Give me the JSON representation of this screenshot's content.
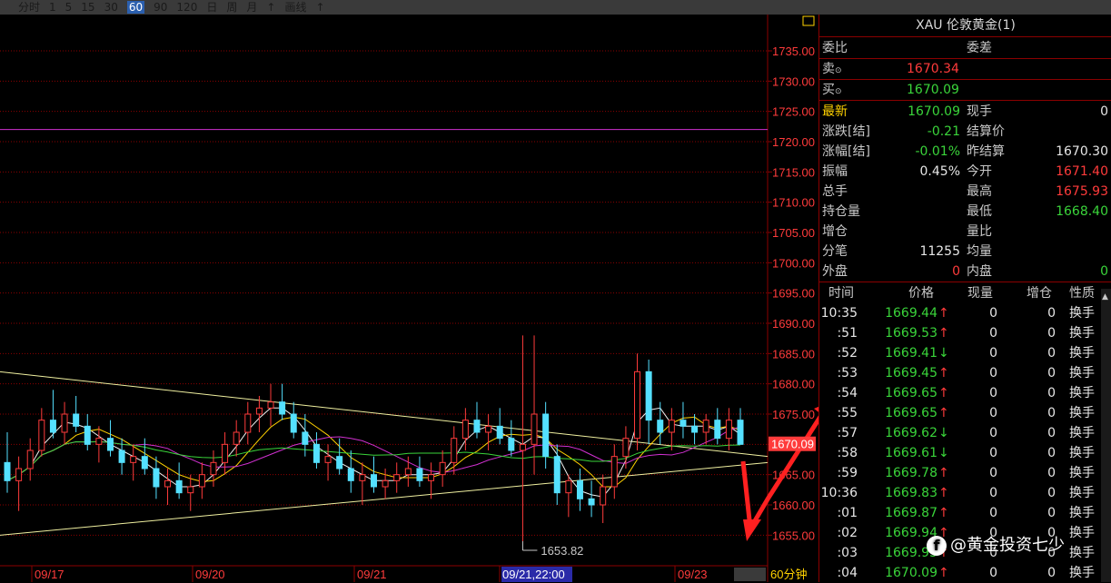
{
  "topbar": {
    "items": [
      "分时",
      "1",
      "5",
      "15",
      "30",
      "60",
      "90",
      "120",
      "日",
      "周",
      "月",
      "↑",
      "画线",
      "↑"
    ],
    "selected_index": 5
  },
  "chart_data": {
    "type": "candlestick",
    "timeframe_label": "60分钟",
    "ylim": [
      1651,
      1741
    ],
    "y_ticks": [
      "1735.00",
      "1730.00",
      "1725.00",
      "1720.00",
      "1715.00",
      "1710.00",
      "1705.00",
      "1700.00",
      "1695.00",
      "1690.00",
      "1685.00",
      "1680.00",
      "1675.00",
      "1670.00",
      "1665.00",
      "1660.00",
      "1655.00"
    ],
    "x_labels": [
      "09/17",
      "09/20",
      "09/21",
      "09/21,22:00",
      "09/23"
    ],
    "x_label_selected": "09/21,22:00",
    "min_annotation": "1653.82",
    "current_price_tag": "1670.09",
    "candles": [
      [
        1667,
        1672,
        1662,
        1664
      ],
      [
        1664,
        1668,
        1659,
        1666
      ],
      [
        1666,
        1671,
        1664,
        1669
      ],
      [
        1669,
        1676,
        1668,
        1674
      ],
      [
        1674,
        1679,
        1671,
        1672
      ],
      [
        1672,
        1677,
        1670,
        1675
      ],
      [
        1675,
        1678,
        1672,
        1673
      ],
      [
        1673,
        1675,
        1669,
        1670
      ],
      [
        1670,
        1673,
        1667,
        1671
      ],
      [
        1671,
        1674,
        1668,
        1669
      ],
      [
        1669,
        1671,
        1665,
        1667
      ],
      [
        1667,
        1670,
        1664,
        1668
      ],
      [
        1668,
        1671,
        1665,
        1666
      ],
      [
        1666,
        1668,
        1661,
        1663
      ],
      [
        1663,
        1666,
        1660,
        1664
      ],
      [
        1664,
        1667,
        1661,
        1662
      ],
      [
        1662,
        1665,
        1659,
        1663
      ],
      [
        1663,
        1667,
        1661,
        1665
      ],
      [
        1665,
        1669,
        1663,
        1667
      ],
      [
        1667,
        1672,
        1665,
        1670
      ],
      [
        1670,
        1674,
        1668,
        1672
      ],
      [
        1672,
        1677,
        1670,
        1675
      ],
      [
        1675,
        1678,
        1672,
        1676
      ],
      [
        1676,
        1680,
        1673,
        1677
      ],
      [
        1677,
        1680,
        1674,
        1675
      ],
      [
        1675,
        1677,
        1671,
        1672
      ],
      [
        1672,
        1675,
        1668,
        1670
      ],
      [
        1670,
        1672,
        1666,
        1667
      ],
      [
        1667,
        1670,
        1664,
        1668
      ],
      [
        1668,
        1671,
        1665,
        1666
      ],
      [
        1666,
        1669,
        1662,
        1664
      ],
      [
        1664,
        1667,
        1660,
        1665
      ],
      [
        1665,
        1668,
        1662,
        1663
      ],
      [
        1663,
        1666,
        1661,
        1664
      ],
      [
        1664,
        1667,
        1662,
        1665
      ],
      [
        1665,
        1668,
        1663,
        1666
      ],
      [
        1666,
        1668,
        1663,
        1664
      ],
      [
        1664,
        1667,
        1661,
        1665
      ],
      [
        1665,
        1669,
        1663,
        1667
      ],
      [
        1667,
        1673,
        1665,
        1671
      ],
      [
        1671,
        1676,
        1669,
        1674
      ],
      [
        1674,
        1677,
        1671,
        1672
      ],
      [
        1672,
        1675,
        1669,
        1673
      ],
      [
        1673,
        1676,
        1670,
        1671
      ],
      [
        1671,
        1674,
        1668,
        1669
      ],
      [
        1669,
        1688,
        1654,
        1670
      ],
      [
        1670,
        1688,
        1665,
        1675
      ],
      [
        1675,
        1677,
        1666,
        1668
      ],
      [
        1668,
        1670,
        1660,
        1662
      ],
      [
        1662,
        1665,
        1658,
        1664
      ],
      [
        1664,
        1666,
        1659,
        1661
      ],
      [
        1661,
        1664,
        1658,
        1660
      ],
      [
        1660,
        1665,
        1657,
        1663
      ],
      [
        1663,
        1670,
        1661,
        1668
      ],
      [
        1668,
        1673,
        1666,
        1671
      ],
      [
        1671,
        1685,
        1669,
        1682
      ],
      [
        1682,
        1684,
        1670,
        1674
      ],
      [
        1674,
        1677,
        1670,
        1672
      ],
      [
        1672,
        1676,
        1669,
        1674
      ],
      [
        1674,
        1677,
        1671,
        1673
      ],
      [
        1673,
        1675,
        1670,
        1672
      ],
      [
        1672,
        1675,
        1670,
        1674
      ],
      [
        1674,
        1676,
        1670,
        1671
      ],
      [
        1671,
        1676,
        1669,
        1674
      ],
      [
        1674,
        1676,
        1670,
        1670
      ]
    ]
  },
  "panel": {
    "title": "XAU 伦敦黄金(1)",
    "header": {
      "weibi_label": "委比",
      "weicha_label": "委差"
    },
    "sell": {
      "label": "卖",
      "value": "1670.34"
    },
    "buy": {
      "label": "买",
      "value": "1670.09"
    },
    "quotes": [
      {
        "l1": "最新",
        "v1": "1670.09",
        "c1": "green",
        "l2": "现手",
        "v2": "0",
        "c2": "white",
        "l1c": "yellow"
      },
      {
        "l1": "涨跌[结]",
        "v1": "-0.21",
        "c1": "green",
        "l2": "结算价",
        "v2": "",
        "c2": "white"
      },
      {
        "l1": "涨幅[结]",
        "v1": "-0.01%",
        "c1": "green",
        "l2": "昨结算",
        "v2": "1670.30",
        "c2": "white"
      },
      {
        "l1": "振幅",
        "v1": "0.45%",
        "c1": "white",
        "l2": "今开",
        "v2": "1671.40",
        "c2": "red"
      },
      {
        "l1": "总手",
        "v1": "",
        "c1": "white",
        "l2": "最高",
        "v2": "1675.93",
        "c2": "red"
      },
      {
        "l1": "持仓量",
        "v1": "",
        "c1": "white",
        "l2": "最低",
        "v2": "1668.40",
        "c2": "green"
      },
      {
        "l1": "增仓",
        "v1": "",
        "c1": "white",
        "l2": "量比",
        "v2": "",
        "c2": "white"
      },
      {
        "l1": "分笔",
        "v1": "11255",
        "c1": "white",
        "l2": "均量",
        "v2": "",
        "c2": "white"
      },
      {
        "l1": "外盘",
        "v1": "0",
        "c1": "red",
        "l2": "内盘",
        "v2": "0",
        "c2": "green"
      }
    ],
    "ticks_header": [
      "时间",
      "价格",
      "现量",
      "增仓",
      "性质"
    ],
    "ticks": [
      {
        "t": "10:35",
        "p": "1669.44",
        "a": "↑",
        "q": "0",
        "z": "0",
        "n": "换手"
      },
      {
        "t": ":51",
        "p": "1669.53",
        "a": "↑",
        "q": "0",
        "z": "0",
        "n": "换手"
      },
      {
        "t": ":52",
        "p": "1669.41",
        "a": "↓",
        "q": "0",
        "z": "0",
        "n": "换手"
      },
      {
        "t": ":53",
        "p": "1669.45",
        "a": "↑",
        "q": "0",
        "z": "0",
        "n": "换手"
      },
      {
        "t": ":54",
        "p": "1669.65",
        "a": "↑",
        "q": "0",
        "z": "0",
        "n": "换手"
      },
      {
        "t": ":55",
        "p": "1669.65",
        "a": "↑",
        "q": "0",
        "z": "0",
        "n": "换手"
      },
      {
        "t": ":57",
        "p": "1669.62",
        "a": "↓",
        "q": "0",
        "z": "0",
        "n": "换手"
      },
      {
        "t": ":58",
        "p": "1669.61",
        "a": "↓",
        "q": "0",
        "z": "0",
        "n": "换手"
      },
      {
        "t": ":59",
        "p": "1669.78",
        "a": "↑",
        "q": "0",
        "z": "0",
        "n": "换手"
      },
      {
        "t": "10:36",
        "p": "1669.83",
        "a": "↑",
        "q": "0",
        "z": "0",
        "n": "换手"
      },
      {
        "t": ":01",
        "p": "1669.87",
        "a": "↑",
        "q": "0",
        "z": "0",
        "n": "换手"
      },
      {
        "t": ":02",
        "p": "1669.94",
        "a": "↑",
        "q": "0",
        "z": "0",
        "n": "换手"
      },
      {
        "t": ":03",
        "p": "1669.95",
        "a": "↑",
        "q": "0",
        "z": "0",
        "n": "换手"
      },
      {
        "t": ":04",
        "p": "1670.09",
        "a": "↑",
        "q": "0",
        "z": "0",
        "n": "换手"
      }
    ]
  },
  "watermark": {
    "icon": "f",
    "text": "@黄金投资七少"
  },
  "colors": {
    "red": "#ff3b3b",
    "green": "#3ad43a",
    "cyan": "#54e0ff",
    "grid": "#8b0000",
    "yellow": "#ffd200"
  }
}
